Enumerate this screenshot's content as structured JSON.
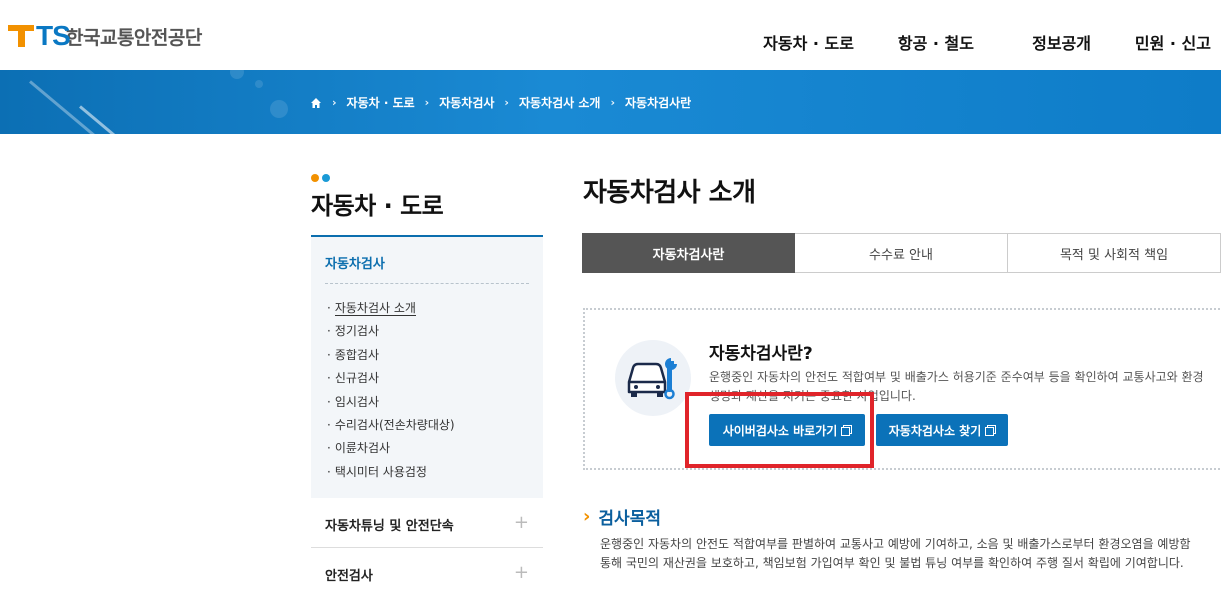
{
  "header": {
    "logo_mark": "TS",
    "logo_text": "한국교통안전공단",
    "nav": [
      "자동차 · 도로",
      "항공 · 철도",
      "정보공개",
      "민원 · 신고"
    ]
  },
  "breadcrumb": [
    "자동차 · 도로",
    "자동차검사",
    "자동차검사 소개",
    "자동차검사란"
  ],
  "sidebar": {
    "title": "자동차 · 도로",
    "section_head": "자동차검사",
    "items": [
      {
        "label": "자동차검사 소개"
      },
      {
        "label": "정기검사"
      },
      {
        "label": "종합검사"
      },
      {
        "label": "신규검사"
      },
      {
        "label": "임시검사"
      },
      {
        "label": "수리검사(전손차량대상)"
      },
      {
        "label": "이륜차검사"
      },
      {
        "label": "택시미터 사용검정"
      }
    ],
    "accordions": [
      "자동차튜닝 및 안전단속",
      "안전검사"
    ]
  },
  "main": {
    "page_title": "자동차검사 소개",
    "tabs": [
      "자동차검사란",
      "수수료 안내",
      "목적 및 사회적 책임"
    ],
    "intro": {
      "title": "자동차검사란?",
      "desc_line1": "운행중인 자동차의 안전도 적합여부 및 배출가스 허용기준 준수여부 등을 확인하여 교통사고와 환경",
      "desc_line2": "생명과 재산을 지키는 중요한 사업입니다.",
      "btn_cyber": "사이버검사소 바로가기",
      "btn_find": "자동차검사소 찾기"
    },
    "purpose": {
      "title": "검사목적",
      "line1": "운행중인 자동차의 안전도 적합여부를 판별하여 교통사고 예방에 기여하고, 소음 및 배출가스로부터 환경오염을 예방함",
      "line2": "통해 국민의 재산권을 보호하고, 책임보험 가입여부 확인 및 불법 튜닝 여부를 확인하여 주행 질서 확립에 기여합니다."
    }
  },
  "colors": {
    "accent": "#0b72b9",
    "orange": "#f29100",
    "highlight": "#e0242a"
  }
}
